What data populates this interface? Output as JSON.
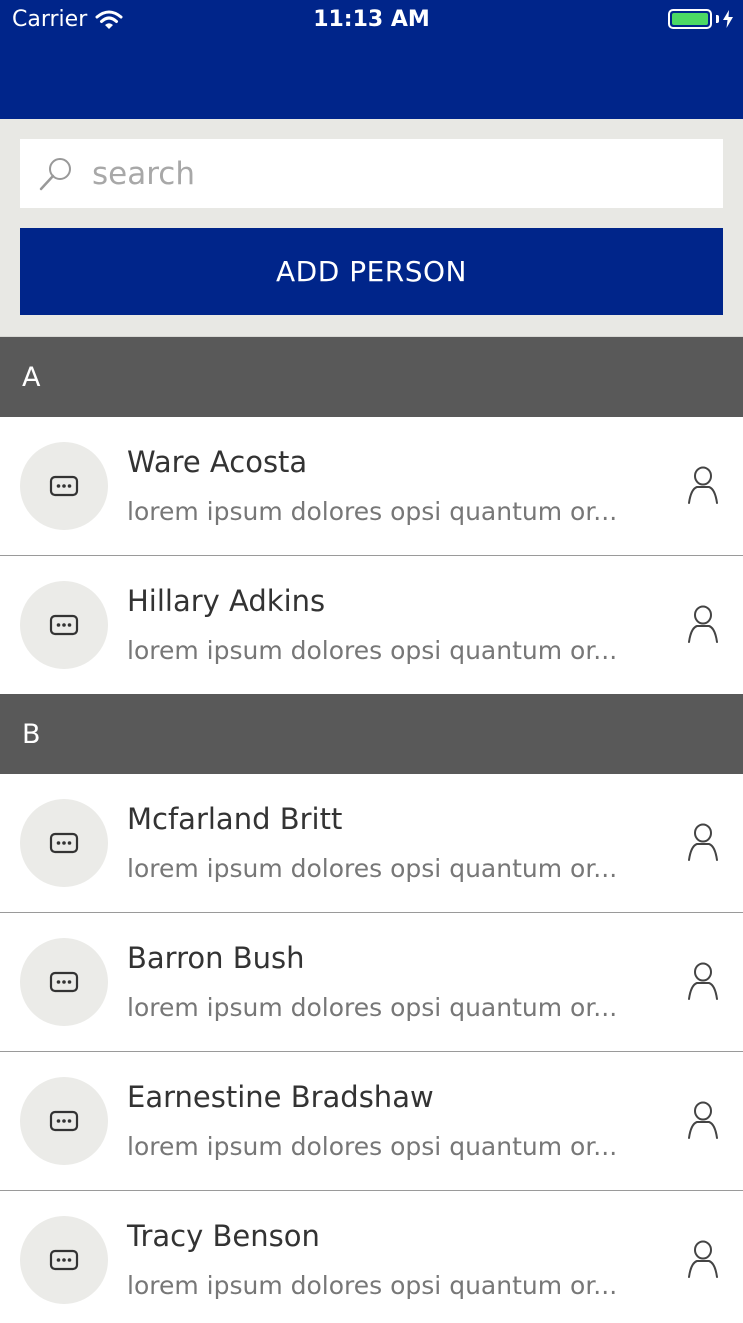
{
  "status_bar": {
    "carrier": "Carrier",
    "time": "11:13 AM",
    "battery_color": "#4cd964"
  },
  "theme": {
    "primary": "#00258a",
    "section_header_bg": "#595959",
    "controls_bg": "#e8e8e4"
  },
  "search": {
    "placeholder": "search",
    "value": ""
  },
  "add_button": {
    "label": "ADD PERSON"
  },
  "sections": [
    {
      "letter": "A",
      "contacts": [
        {
          "name": "Ware Acosta",
          "description": "lorem ipsum dolores opsi quantum or..."
        },
        {
          "name": "Hillary Adkins",
          "description": "lorem ipsum dolores opsi quantum or..."
        }
      ]
    },
    {
      "letter": "B",
      "contacts": [
        {
          "name": "Mcfarland Britt",
          "description": "lorem ipsum dolores opsi quantum or..."
        },
        {
          "name": "Barron Bush",
          "description": "lorem ipsum dolores opsi quantum or..."
        },
        {
          "name": "Earnestine Bradshaw",
          "description": "lorem ipsum dolores opsi quantum or..."
        },
        {
          "name": "Tracy Benson",
          "description": "lorem ipsum dolores opsi quantum or..."
        }
      ]
    }
  ],
  "icons": {
    "avatar": "message-icon",
    "row_action": "person-icon",
    "search": "search-icon",
    "wifi": "wifi-icon",
    "battery": "battery-icon",
    "charging": "charging-bolt-icon"
  }
}
